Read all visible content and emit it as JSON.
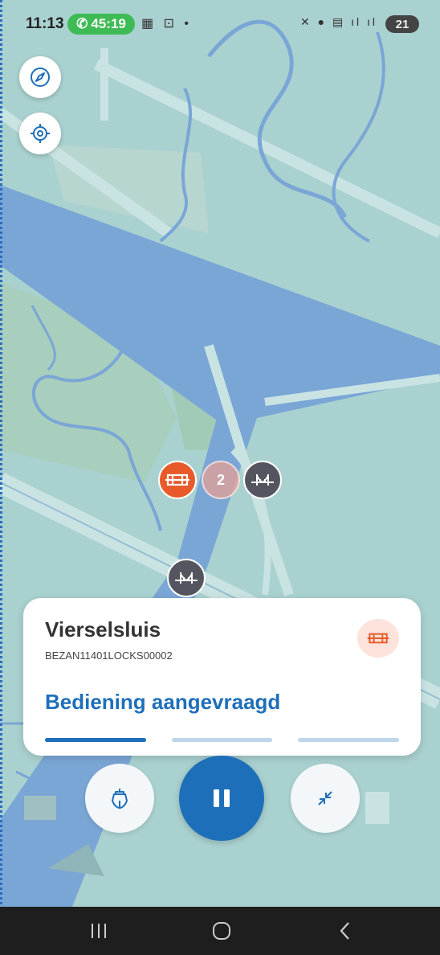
{
  "status_bar": {
    "time": "11:13",
    "call_timer": "45:19",
    "battery": "21"
  },
  "map": {
    "cluster_count": "2"
  },
  "card": {
    "title": "Vierselsluis",
    "code": "BEZAN11401LOCKS00002",
    "status": "Bediening aangevraagd",
    "progress_step": 1,
    "progress_total": 3
  },
  "icons": {
    "compass": "compass-icon",
    "locate": "locate-icon",
    "lock": "lock-icon",
    "bridge": "bridge-icon",
    "boat": "boat-icon",
    "pause": "pause-icon",
    "collapse": "collapse-icon"
  },
  "colors": {
    "accent": "#1e6fba",
    "lock": "#e85a2a",
    "bridge": "#555560",
    "water": "#7aa6d6",
    "land": "#a9d1cf"
  }
}
